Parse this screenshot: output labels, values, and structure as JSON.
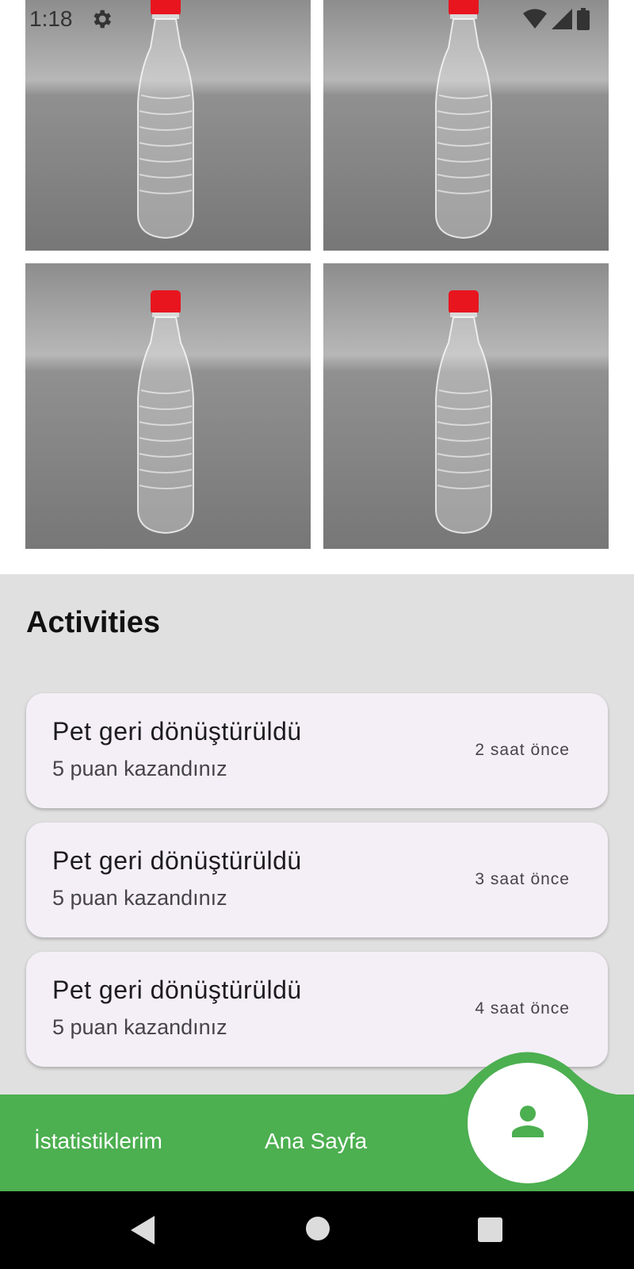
{
  "status_bar": {
    "time": "1:18",
    "icons": [
      "settings-gear-icon",
      "wifi-icon",
      "cell-signal-icon",
      "battery-icon"
    ]
  },
  "gallery": {
    "items": [
      {
        "icon": "pet-bottle-image"
      },
      {
        "icon": "pet-bottle-image"
      },
      {
        "icon": "pet-bottle-image"
      },
      {
        "icon": "pet-bottle-image"
      }
    ]
  },
  "activities": {
    "title": "Activities",
    "items": [
      {
        "title": "Pet geri dönüştürüldü",
        "subtitle": "5 puan kazandınız",
        "time": "2 saat önce"
      },
      {
        "title": "Pet geri dönüştürüldü",
        "subtitle": "5 puan kazandınız",
        "time": "3 saat önce"
      },
      {
        "title": "Pet geri dönüştürüldü",
        "subtitle": "5 puan kazandınız",
        "time": "4 saat önce"
      }
    ]
  },
  "bottom_nav": {
    "stats_label": "İstatistiklerim",
    "home_label": "Ana Sayfa",
    "profile_icon": "person-icon"
  },
  "system_nav": {
    "icons": [
      "back-icon",
      "home-circle-icon",
      "recents-square-icon"
    ]
  },
  "colors": {
    "accent": "#4caf50",
    "card_bg": "#f4eff7",
    "section_bg": "#e0e0e0",
    "bottle_cap": "#e8151f"
  }
}
